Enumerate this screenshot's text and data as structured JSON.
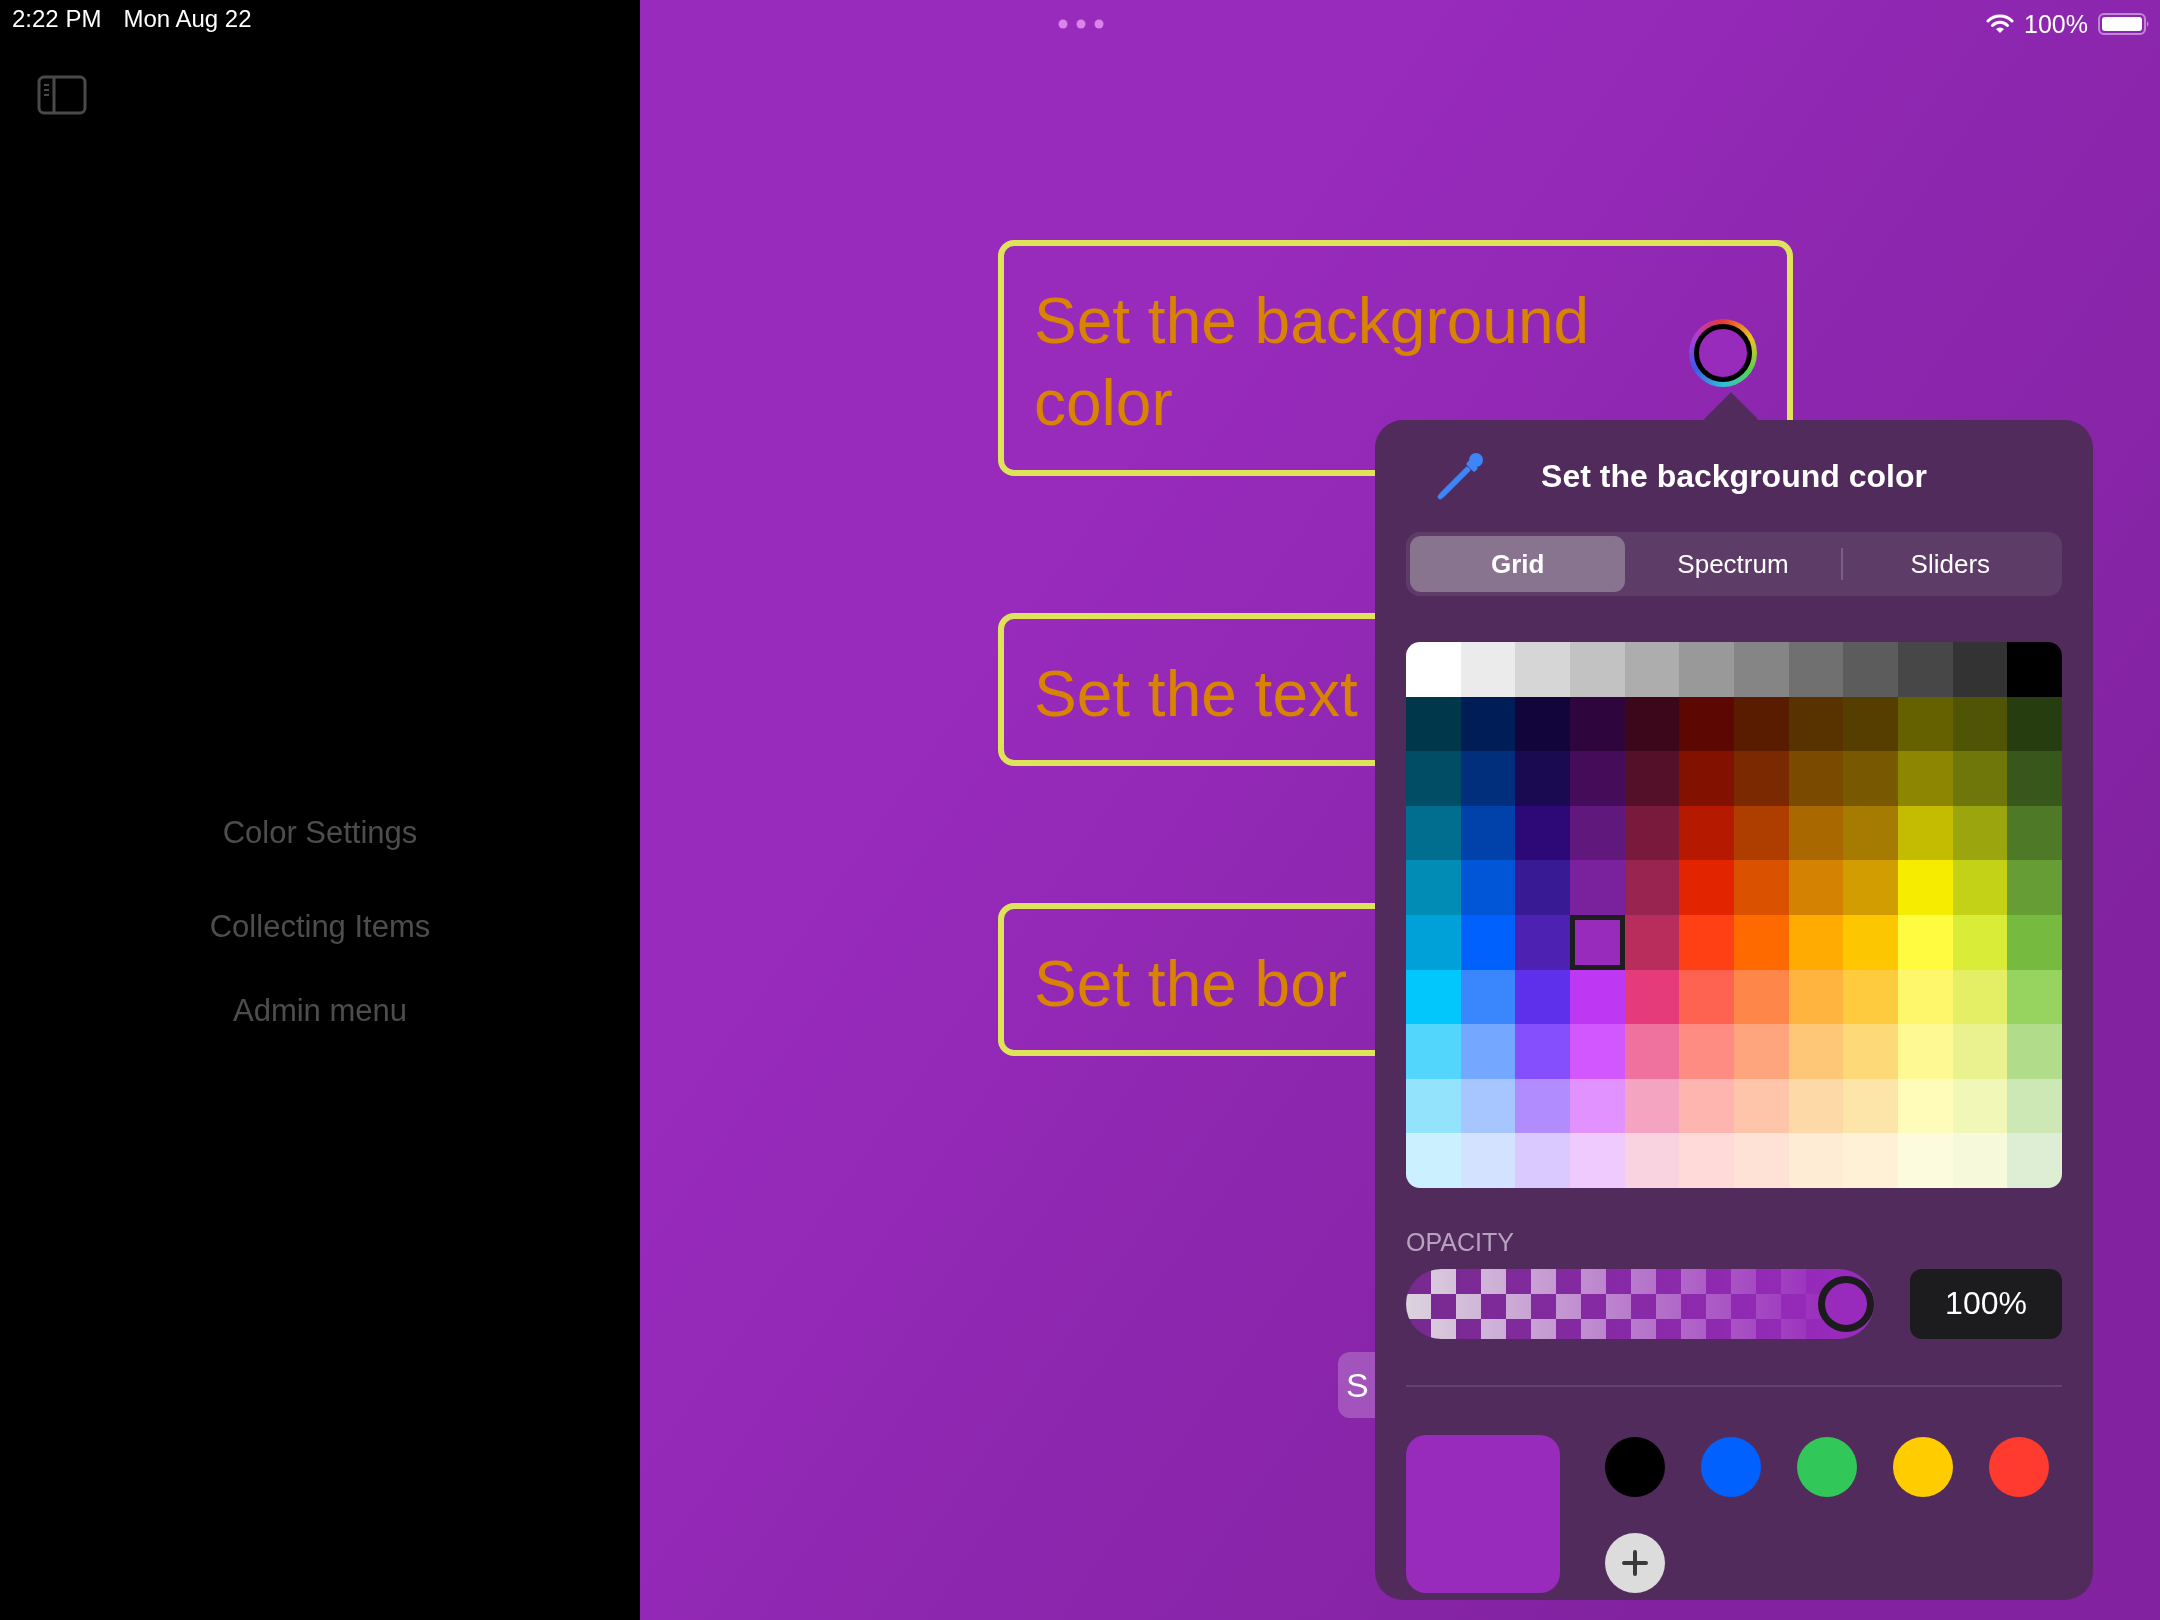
{
  "status_bar": {
    "time": "2:22 PM",
    "date": "Mon Aug 22",
    "battery": "100%"
  },
  "sidebar": {
    "items": [
      {
        "label": "Color Settings"
      },
      {
        "label": "Collecting Items"
      },
      {
        "label": "Admin menu"
      }
    ]
  },
  "cards": [
    {
      "text": "Set the background color",
      "color_well": true
    },
    {
      "text": "Set the text",
      "color_well": false
    },
    {
      "text": "Set the bor",
      "color_well": false
    }
  ],
  "partial_button": {
    "label": "S"
  },
  "color_picker": {
    "title": "Set the background color",
    "tabs": [
      {
        "label": "Grid",
        "selected": true
      },
      {
        "label": "Spectrum",
        "selected": false
      },
      {
        "label": "Sliders",
        "selected": false
      }
    ],
    "grid": [
      [
        {
          "color": "#ffffff",
          "selected": false
        },
        {
          "color": "#ebebeb",
          "selected": false
        },
        {
          "color": "#d6d6d6",
          "selected": false
        },
        {
          "color": "#c2c2c2",
          "selected": false
        },
        {
          "color": "#adadad",
          "selected": false
        },
        {
          "color": "#999999",
          "selected": false
        },
        {
          "color": "#858585",
          "selected": false
        },
        {
          "color": "#707070",
          "selected": false
        },
        {
          "color": "#5c5c5c",
          "selected": false
        },
        {
          "color": "#474747",
          "selected": false
        },
        {
          "color": "#333333",
          "selected": false
        },
        {
          "color": "#000000",
          "selected": false
        }
      ],
      [
        {
          "color": "#00374a",
          "selected": false
        },
        {
          "color": "#011d57",
          "selected": false
        },
        {
          "color": "#11053b",
          "selected": false
        },
        {
          "color": "#2e063d",
          "selected": false
        },
        {
          "color": "#3c071b",
          "selected": false
        },
        {
          "color": "#5c0701",
          "selected": false
        },
        {
          "color": "#5a1c00",
          "selected": false
        },
        {
          "color": "#583300",
          "selected": false
        },
        {
          "color": "#563d00",
          "selected": false
        },
        {
          "color": "#666100",
          "selected": false
        },
        {
          "color": "#4f5504",
          "selected": false
        },
        {
          "color": "#263e0f",
          "selected": false
        }
      ],
      [
        {
          "color": "#004d65",
          "selected": false
        },
        {
          "color": "#012f7b",
          "selected": false
        },
        {
          "color": "#1a0a52",
          "selected": false
        },
        {
          "color": "#450d59",
          "selected": false
        },
        {
          "color": "#551029",
          "selected": false
        },
        {
          "color": "#831100",
          "selected": false
        },
        {
          "color": "#7b2900",
          "selected": false
        },
        {
          "color": "#7a4a00",
          "selected": false
        },
        {
          "color": "#785800",
          "selected": false
        },
        {
          "color": "#8c8602",
          "selected": false
        },
        {
          "color": "#6f760a",
          "selected": false
        },
        {
          "color": "#38571a",
          "selected": false
        }
      ],
      [
        {
          "color": "#016e8f",
          "selected": false
        },
        {
          "color": "#0042a9",
          "selected": false
        },
        {
          "color": "#2c0977",
          "selected": false
        },
        {
          "color": "#61187c",
          "selected": false
        },
        {
          "color": "#791a3d",
          "selected": false
        },
        {
          "color": "#b51a00",
          "selected": false
        },
        {
          "color": "#ad3e00",
          "selected": false
        },
        {
          "color": "#a96800",
          "selected": false
        },
        {
          "color": "#a67b01",
          "selected": false
        },
        {
          "color": "#c4bc00",
          "selected": false
        },
        {
          "color": "#9ba50e",
          "selected": false
        },
        {
          "color": "#4e7a27",
          "selected": false
        }
      ],
      [
        {
          "color": "#008cb4",
          "selected": false
        },
        {
          "color": "#0056d6",
          "selected": false
        },
        {
          "color": "#371a94",
          "selected": false
        },
        {
          "color": "#7a219e",
          "selected": false
        },
        {
          "color": "#99244f",
          "selected": false
        },
        {
          "color": "#e22400",
          "selected": false
        },
        {
          "color": "#da5100",
          "selected": false
        },
        {
          "color": "#d38301",
          "selected": false
        },
        {
          "color": "#d19d01",
          "selected": false
        },
        {
          "color": "#f5ec00",
          "selected": false
        },
        {
          "color": "#c3d117",
          "selected": false
        },
        {
          "color": "#669d34",
          "selected": false
        }
      ],
      [
        {
          "color": "#00a1d8",
          "selected": false
        },
        {
          "color": "#0061fd",
          "selected": false
        },
        {
          "color": "#4d22b2",
          "selected": false
        },
        {
          "color": "#982abc",
          "selected": true
        },
        {
          "color": "#b92d5d",
          "selected": false
        },
        {
          "color": "#ff4015",
          "selected": false
        },
        {
          "color": "#ff6a00",
          "selected": false
        },
        {
          "color": "#ffab01",
          "selected": false
        },
        {
          "color": "#fcc700",
          "selected": false
        },
        {
          "color": "#fefb41",
          "selected": false
        },
        {
          "color": "#d9ec37",
          "selected": false
        },
        {
          "color": "#76bb40",
          "selected": false
        }
      ],
      [
        {
          "color": "#01c7fc",
          "selected": false
        },
        {
          "color": "#3a87fd",
          "selected": false
        },
        {
          "color": "#5e30eb",
          "selected": false
        },
        {
          "color": "#be38f3",
          "selected": false
        },
        {
          "color": "#e63b7a",
          "selected": false
        },
        {
          "color": "#fe6250",
          "selected": false
        },
        {
          "color": "#fe8648",
          "selected": false
        },
        {
          "color": "#feb43f",
          "selected": false
        },
        {
          "color": "#fecb3e",
          "selected": false
        },
        {
          "color": "#fff76b",
          "selected": false
        },
        {
          "color": "#e4ef65",
          "selected": false
        },
        {
          "color": "#96d35f",
          "selected": false
        }
      ],
      [
        {
          "color": "#52d6fc",
          "selected": false
        },
        {
          "color": "#74a7ff",
          "selected": false
        },
        {
          "color": "#864ffd",
          "selected": false
        },
        {
          "color": "#d357fe",
          "selected": false
        },
        {
          "color": "#ee719e",
          "selected": false
        },
        {
          "color": "#ff8c82",
          "selected": false
        },
        {
          "color": "#fea57d",
          "selected": false
        },
        {
          "color": "#fec777",
          "selected": false
        },
        {
          "color": "#fed977",
          "selected": false
        },
        {
          "color": "#fff994",
          "selected": false
        },
        {
          "color": "#eaf28f",
          "selected": false
        },
        {
          "color": "#b1dd8b",
          "selected": false
        }
      ],
      [
        {
          "color": "#93e3fc",
          "selected": false
        },
        {
          "color": "#a7c6ff",
          "selected": false
        },
        {
          "color": "#b18cfe",
          "selected": false
        },
        {
          "color": "#e292fe",
          "selected": false
        },
        {
          "color": "#f4a4c0",
          "selected": false
        },
        {
          "color": "#ffb5af",
          "selected": false
        },
        {
          "color": "#ffc5ab",
          "selected": false
        },
        {
          "color": "#fed9a8",
          "selected": false
        },
        {
          "color": "#fde4a8",
          "selected": false
        },
        {
          "color": "#fffbb9",
          "selected": false
        },
        {
          "color": "#f1f7b7",
          "selected": false
        },
        {
          "color": "#cde8b5",
          "selected": false
        }
      ],
      [
        {
          "color": "#cbf0ff",
          "selected": false
        },
        {
          "color": "#d3e2ff",
          "selected": false
        },
        {
          "color": "#d9c9fe",
          "selected": false
        },
        {
          "color": "#efcaff",
          "selected": false
        },
        {
          "color": "#f9d3e0",
          "selected": false
        },
        {
          "color": "#ffdad8",
          "selected": false
        },
        {
          "color": "#ffe2d6",
          "selected": false
        },
        {
          "color": "#feecd4",
          "selected": false
        },
        {
          "color": "#fef1d5",
          "selected": false
        },
        {
          "color": "#fdfbdd",
          "selected": false
        },
        {
          "color": "#f6fadb",
          "selected": false
        },
        {
          "color": "#deeed4",
          "selected": false
        }
      ]
    ],
    "opacity": {
      "label": "OPACITY",
      "level": 1,
      "reading": "100%"
    },
    "swatches": [
      {
        "color": "#000000"
      },
      {
        "color": "#0061fe"
      },
      {
        "color": "#32c759"
      },
      {
        "color": "#ffcc00"
      },
      {
        "color": "#ff3b30"
      }
    ]
  }
}
